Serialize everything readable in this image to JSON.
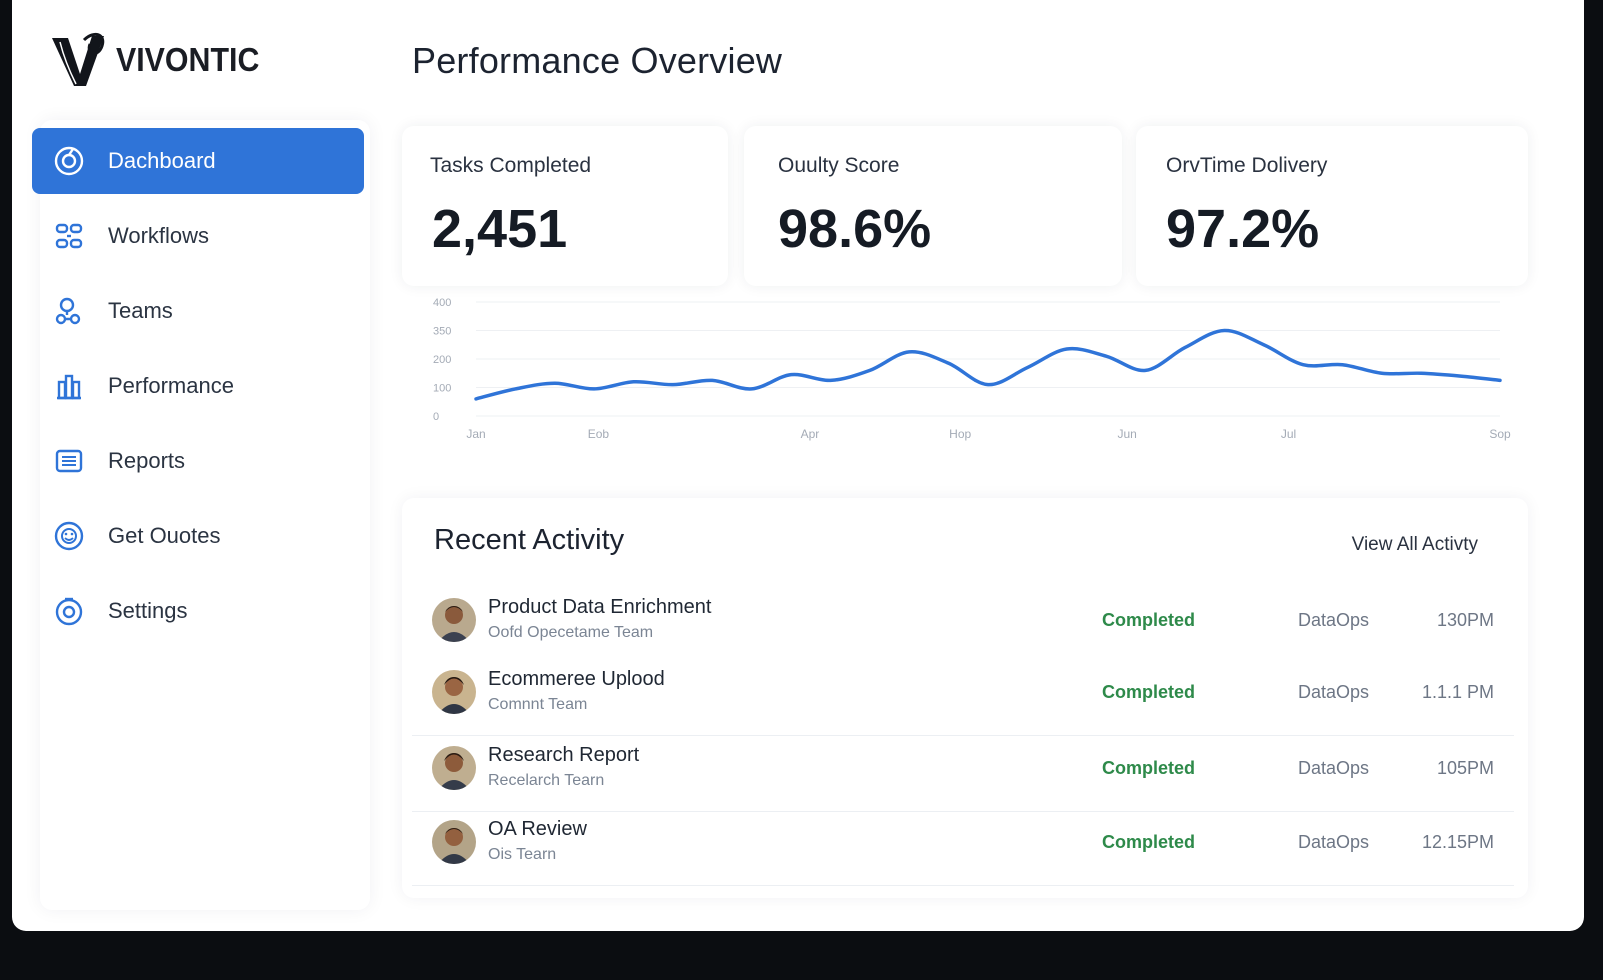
{
  "brand": {
    "name": "VIVONTIC",
    "tagline": "",
    "accent_color": "#2f74d8"
  },
  "sidebar": {
    "items": [
      {
        "label": "Dachboard",
        "icon": "dashboard-icon",
        "active": true
      },
      {
        "label": "Workflows",
        "icon": "workflows-icon",
        "active": false
      },
      {
        "label": "Teams",
        "icon": "teams-icon",
        "active": false
      },
      {
        "label": "Performance",
        "icon": "performance-icon",
        "active": false
      },
      {
        "label": "Reports",
        "icon": "reports-icon",
        "active": false
      },
      {
        "label": "Get Ouotes",
        "icon": "quotes-icon",
        "active": false
      },
      {
        "label": "Settings",
        "icon": "settings-icon",
        "active": false
      }
    ]
  },
  "header": {
    "title": "Performance Overview"
  },
  "kpis": [
    {
      "label": "Tasks Completed",
      "value": "2,451"
    },
    {
      "label": "Ouulty Score",
      "value": "98.6%"
    },
    {
      "label": "OrvTime Dolivery",
      "value": "97.2%"
    }
  ],
  "chart_data": {
    "type": "line",
    "title": "",
    "xlabel": "",
    "ylabel": "",
    "y_ticks": [
      "400",
      "350",
      "200",
      "100",
      "0"
    ],
    "x_ticks": [
      "Jan",
      "Eob",
      "Apr",
      "Hop",
      "Jun",
      "Jul",
      "Sop"
    ],
    "grid": true,
    "line_color": "#2f74d8",
    "series": [
      {
        "name": "",
        "x": [
          0,
          0.5,
          1,
          1.5,
          2,
          2.5,
          3,
          3.5,
          4,
          4.5,
          5,
          5.5,
          6,
          6.5,
          7,
          7.5,
          8,
          8.5,
          9,
          9.5,
          10,
          10.5,
          11,
          11.5,
          12,
          12.5,
          13
        ],
        "values": [
          60,
          95,
          115,
          95,
          120,
          110,
          125,
          95,
          145,
          125,
          160,
          225,
          185,
          110,
          170,
          235,
          210,
          160,
          240,
          300,
          250,
          180,
          180,
          150,
          150,
          140,
          125
        ]
      }
    ]
  },
  "activity": {
    "title": "Recent Activity",
    "view_all": "View All Activty",
    "rows": [
      {
        "title": "Product Data Enrichment",
        "subtitle": "Oofd Opecetame Team",
        "status": "Completed",
        "team": "DataOps",
        "time": "130PM"
      },
      {
        "title": "Ecommeree Uplood",
        "subtitle": "Comnnt Team",
        "status": "Completed",
        "team": "DataOps",
        "time": "1.1.1 PM"
      },
      {
        "title": "Research Report",
        "subtitle": "Recelarch Tearn",
        "status": "Completed",
        "team": "DataOps",
        "time": "105PM"
      },
      {
        "title": "OA Review",
        "subtitle": "Ois Tearn",
        "status": "Completed",
        "team": "DataOps",
        "time": "12.15PM"
      }
    ]
  }
}
